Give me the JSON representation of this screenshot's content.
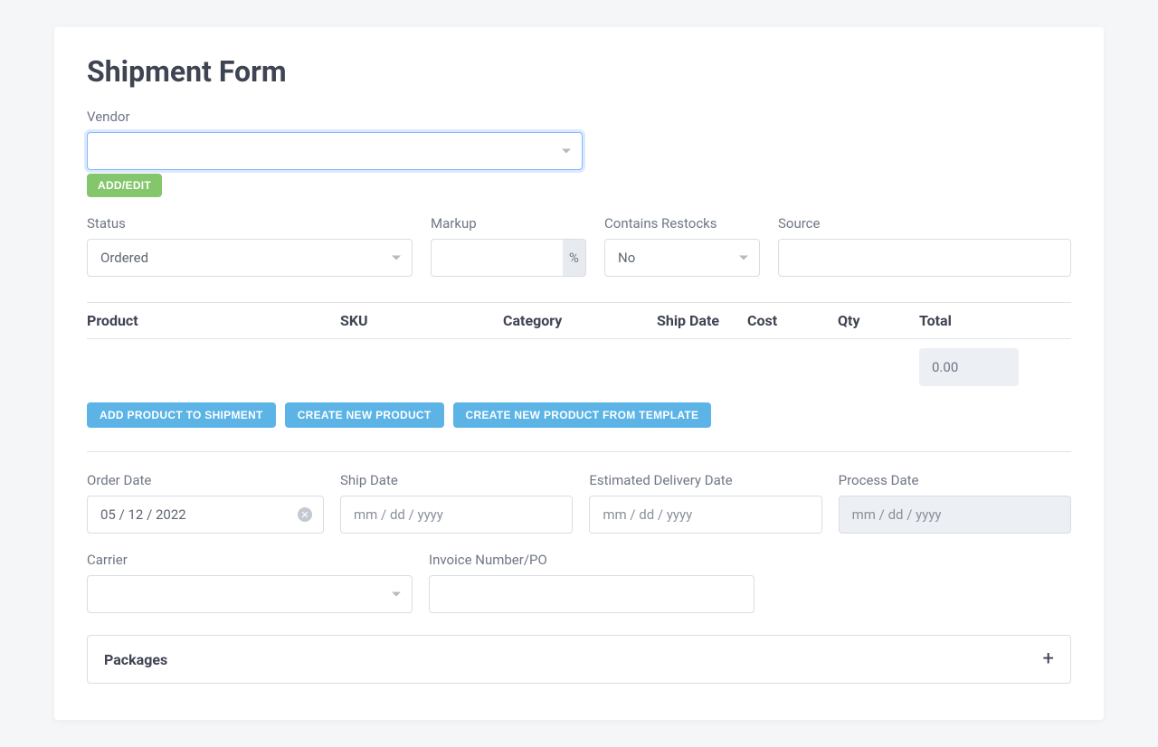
{
  "title": "Shipment Form",
  "vendor": {
    "label": "Vendor",
    "value": "",
    "addEdit": "Add/Edit"
  },
  "status": {
    "label": "Status",
    "value": "Ordered"
  },
  "markup": {
    "label": "Markup",
    "value": "",
    "suffix": "%"
  },
  "restocks": {
    "label": "Contains Restocks",
    "value": "No"
  },
  "source": {
    "label": "Source",
    "value": ""
  },
  "table": {
    "headers": {
      "product": "Product",
      "sku": "SKU",
      "category": "Category",
      "shipDate": "Ship Date",
      "cost": "Cost",
      "qty": "Qty",
      "total": "Total"
    },
    "totalValue": "0.00"
  },
  "buttons": {
    "addProduct": "Add Product to Shipment",
    "createProduct": "Create New Product",
    "createFromTemplate": "Create New Product from Template"
  },
  "dates": {
    "order": {
      "label": "Order Date",
      "value": "05 / 12 / 2022"
    },
    "ship": {
      "label": "Ship Date",
      "placeholder": "mm / dd / yyyy"
    },
    "delivery": {
      "label": "Estimated Delivery Date",
      "placeholder": "mm / dd / yyyy"
    },
    "process": {
      "label": "Process Date",
      "placeholder": "mm / dd / yyyy"
    }
  },
  "carrier": {
    "label": "Carrier",
    "value": ""
  },
  "invoice": {
    "label": "Invoice Number/PO",
    "value": ""
  },
  "packages": {
    "title": "Packages"
  }
}
